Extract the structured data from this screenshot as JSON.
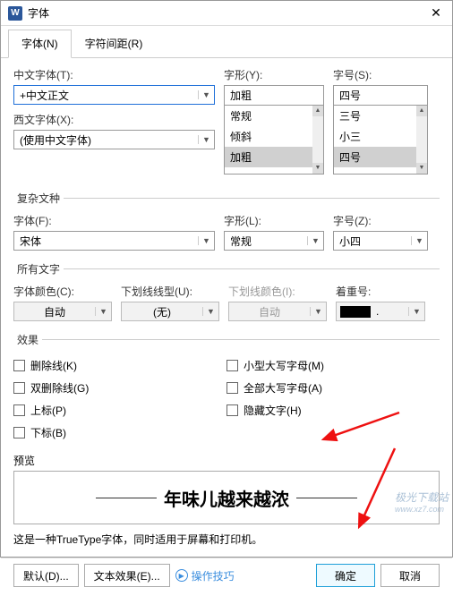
{
  "window": {
    "title": "字体"
  },
  "tabs": {
    "font": "字体(N)",
    "spacing": "字符间距(R)"
  },
  "labels": {
    "cjk_font": "中文字体(T):",
    "western_font": "西文字体(X):",
    "style": "字形(Y):",
    "size": "字号(S):",
    "complex": "复杂文种",
    "font_f": "字体(F):",
    "style_l": "字形(L):",
    "size_z": "字号(Z):",
    "all_text": "所有文字",
    "font_color": "字体颜色(C):",
    "underline": "下划线线型(U):",
    "underline_color": "下划线颜色(I):",
    "emphasis": "着重号:",
    "effects": "效果",
    "preview": "预览"
  },
  "values": {
    "cjk_font": "+中文正文",
    "western_font": "(使用中文字体)",
    "style_input": "加粗",
    "style_opts": [
      "常规",
      "倾斜",
      "加粗"
    ],
    "style_sel": "加粗",
    "size_input": "四号",
    "size_opts": [
      "三号",
      "小三",
      "四号"
    ],
    "size_sel": "四号",
    "font_f": "宋体",
    "style_l": "常规",
    "size_z": "小四",
    "font_color": "自动",
    "underline": "(无)",
    "underline_color": "自动",
    "emphasis": "."
  },
  "checks": {
    "strike": "删除线(K)",
    "dstrike": "双删除线(G)",
    "super": "上标(P)",
    "sub": "下标(B)",
    "smallcaps": "小型大写字母(M)",
    "allcaps": "全部大写字母(A)",
    "hidden": "隐藏文字(H)"
  },
  "preview_text": "年味儿越来越浓",
  "note": "这是一种TrueType字体，同时适用于屏幕和打印机。",
  "buttons": {
    "default": "默认(D)...",
    "text_effect": "文本效果(E)...",
    "tips": "操作技巧",
    "ok": "确定",
    "cancel": "取消"
  },
  "watermark": {
    "main": "极光下载站",
    "sub": "www.xz7.com"
  }
}
